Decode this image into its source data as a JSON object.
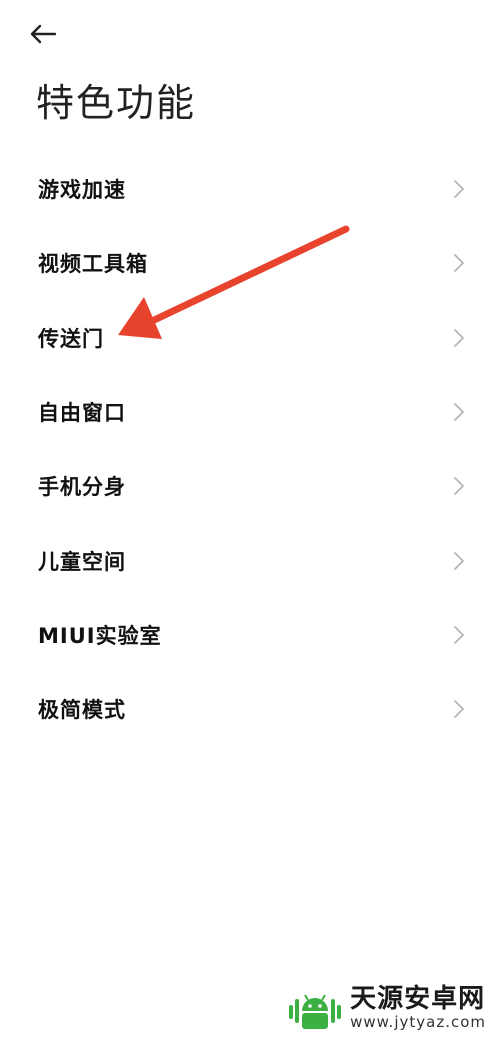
{
  "header": {
    "back_icon": "arrow-left-icon",
    "title": "特色功能"
  },
  "menu": {
    "items": [
      {
        "label": "游戏加速",
        "icon": "chevron-right-icon"
      },
      {
        "label": "视频工具箱",
        "icon": "chevron-right-icon"
      },
      {
        "label": "传送门",
        "icon": "chevron-right-icon"
      },
      {
        "label": "自由窗口",
        "icon": "chevron-right-icon"
      },
      {
        "label": "手机分身",
        "icon": "chevron-right-icon"
      },
      {
        "label": "儿童空间",
        "icon": "chevron-right-icon"
      },
      {
        "label": "MIUI实验室",
        "icon": "chevron-right-icon"
      },
      {
        "label": "极简模式",
        "icon": "chevron-right-icon"
      }
    ]
  },
  "annotation": {
    "arrow_color": "#e8432d",
    "points_to": "传送门"
  },
  "watermark": {
    "title": "天源安卓网",
    "url": "www.jytyaz.com",
    "logo_color": "#3cb043"
  }
}
